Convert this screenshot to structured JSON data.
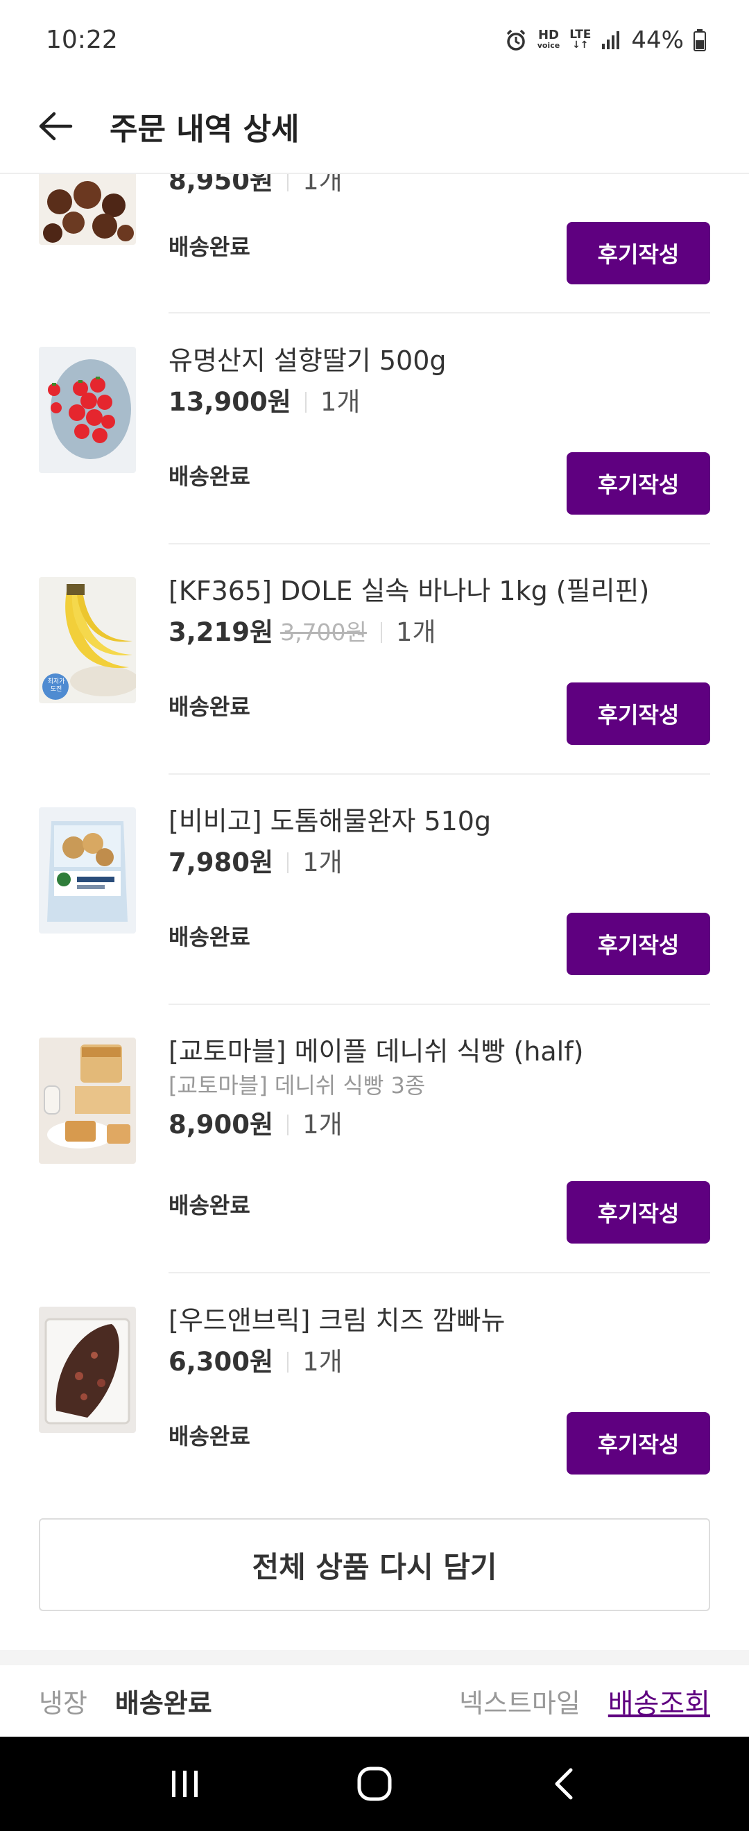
{
  "status_bar": {
    "time": "10:22",
    "hd_label": "HD",
    "voice_label": "voice",
    "lte_label": "LTE",
    "battery_text": "44%"
  },
  "header": {
    "title": "주문 내역 상세"
  },
  "items": [
    {
      "name": "",
      "price": "8,950원",
      "qty": "1개",
      "status": "배송완료",
      "review_label": "후기작성",
      "thumb_icon": "chestnut-image"
    },
    {
      "name": "유명산지 설향딸기 500g",
      "price": "13,900원",
      "qty": "1개",
      "status": "배송완료",
      "review_label": "후기작성",
      "thumb_icon": "strawberry-image"
    },
    {
      "name": "[KF365] DOLE 실속 바나나 1kg (필리핀)",
      "price": "3,219원",
      "orig_price": "3,700원",
      "qty": "1개",
      "status": "배송완료",
      "review_label": "후기작성",
      "thumb_icon": "banana-image",
      "thumb_badge": "최저가 도전"
    },
    {
      "name": "[비비고] 도톰해물완자 510g",
      "price": "7,980원",
      "qty": "1개",
      "status": "배송완료",
      "review_label": "후기작성",
      "thumb_icon": "fishball-package-image"
    },
    {
      "name": "[교토마블] 메이플 데니쉬 식빵 (half)",
      "subname": "[교토마블] 데니쉬 식빵 3종",
      "price": "8,900원",
      "qty": "1개",
      "status": "배송완료",
      "review_label": "후기작성",
      "thumb_icon": "bread-image"
    },
    {
      "name": "[우드앤브릭] 크림 치즈 깜빠뉴",
      "price": "6,300원",
      "qty": "1개",
      "status": "배송완료",
      "review_label": "후기작성",
      "thumb_icon": "campagne-image"
    }
  ],
  "readd_all_label": "전체 상품 다시 담기",
  "delivery": {
    "type": "냉장",
    "status": "배송완료",
    "carrier": "넥스트마일",
    "track_label": "배송조회"
  },
  "colors": {
    "accent": "#5f0080",
    "text": "#333333",
    "muted": "#999999"
  }
}
